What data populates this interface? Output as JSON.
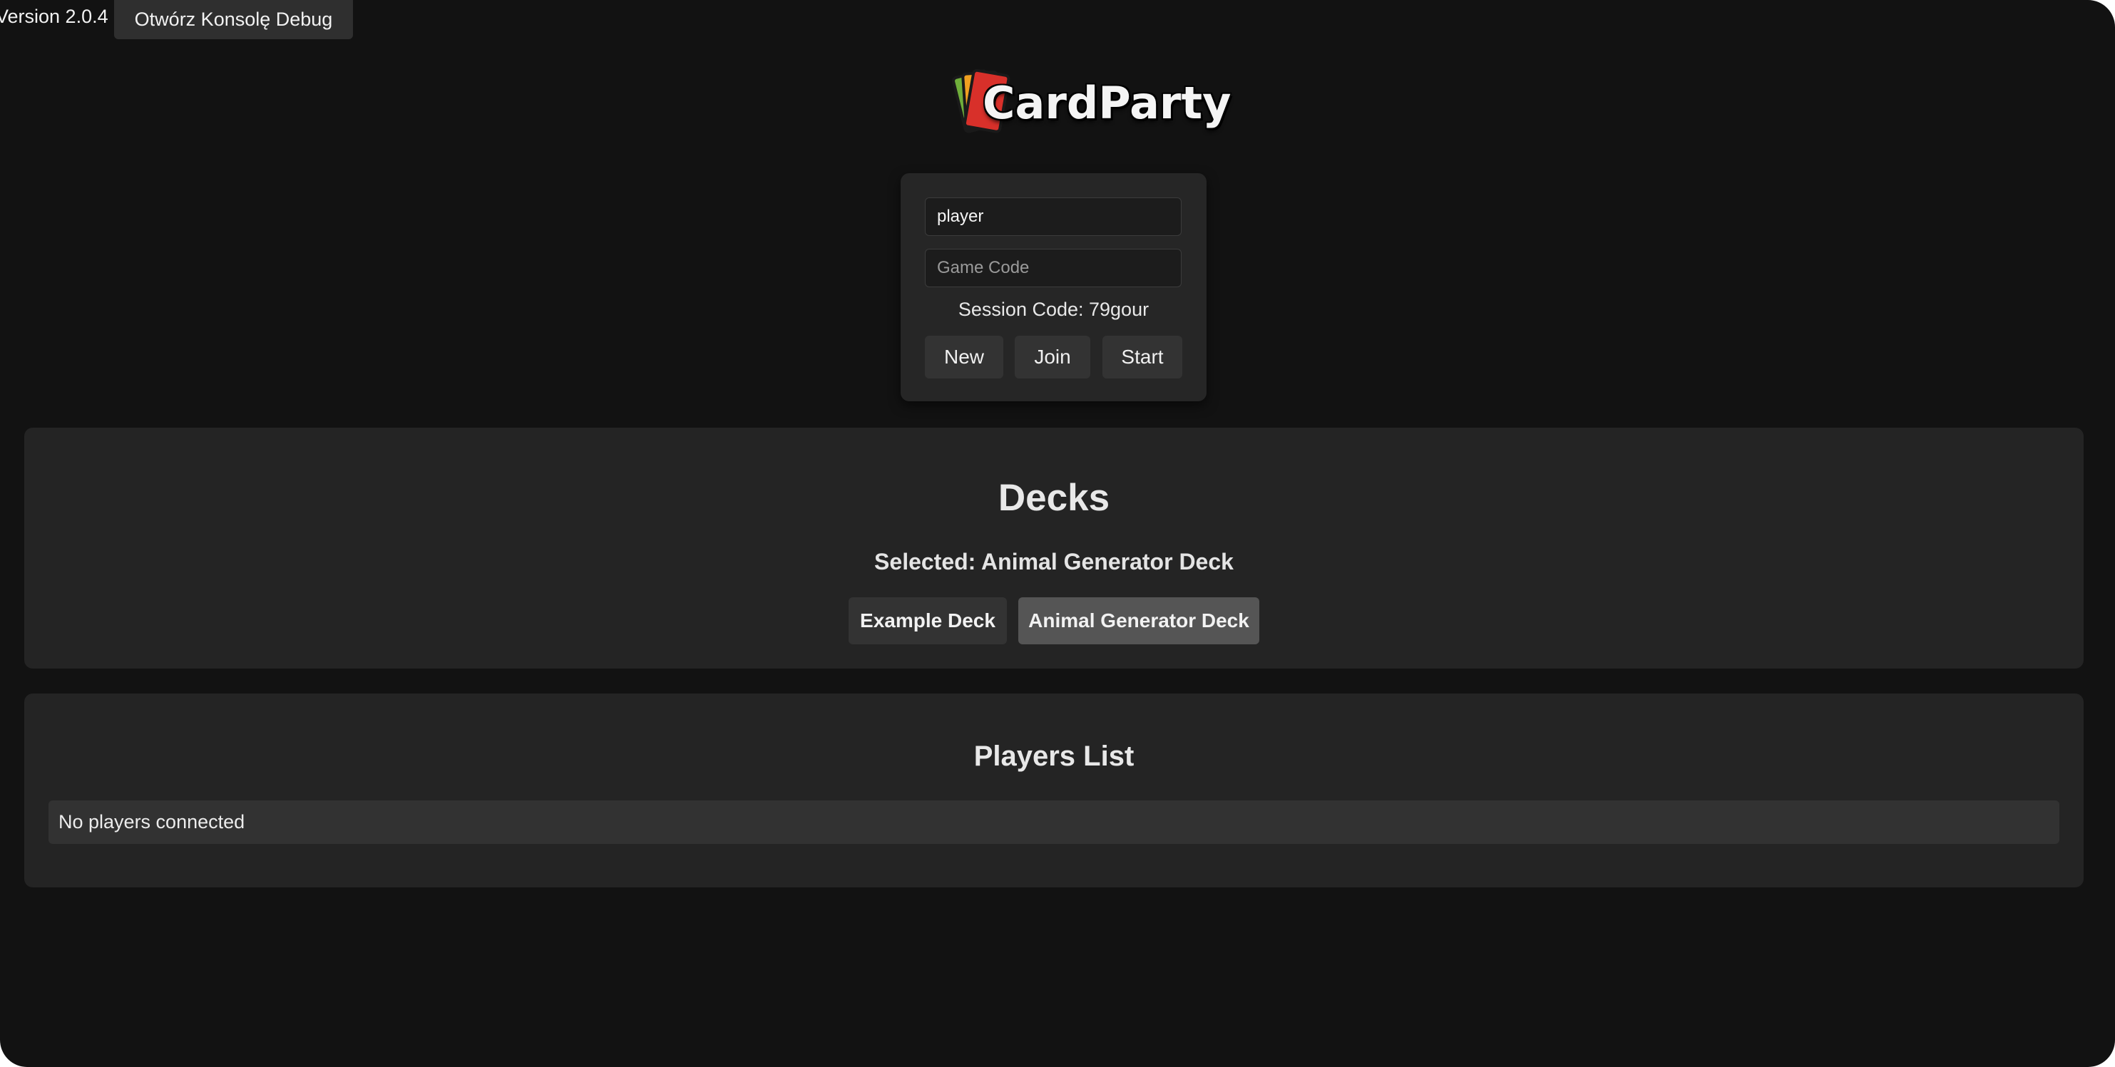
{
  "header": {
    "version": "Version 2.0.4",
    "debug_button": "Otwórz Konsolę Debug"
  },
  "logo": {
    "text": "CardParty",
    "icon": "stacked-cards-logo-icon",
    "card_colors": [
      "#6fae3a",
      "#f0a020",
      "#d8302a"
    ]
  },
  "login": {
    "player_name_value": "player",
    "game_code_placeholder": "Game Code",
    "session_label": "Session Code: 79gour",
    "buttons": {
      "new": "New",
      "join": "Join",
      "start": "Start"
    }
  },
  "decks": {
    "title": "Decks",
    "selected": "Selected: Animal Generator Deck",
    "items": [
      {
        "label": "Example Deck",
        "active": false
      },
      {
        "label": "Animal Generator Deck",
        "active": true
      }
    ]
  },
  "players": {
    "title": "Players List",
    "empty_message": "No players connected"
  },
  "colors": {
    "background": "#121212",
    "panel": "#242424",
    "button": "#333333",
    "button_active": "#555555",
    "text": "#e8e8e8"
  }
}
